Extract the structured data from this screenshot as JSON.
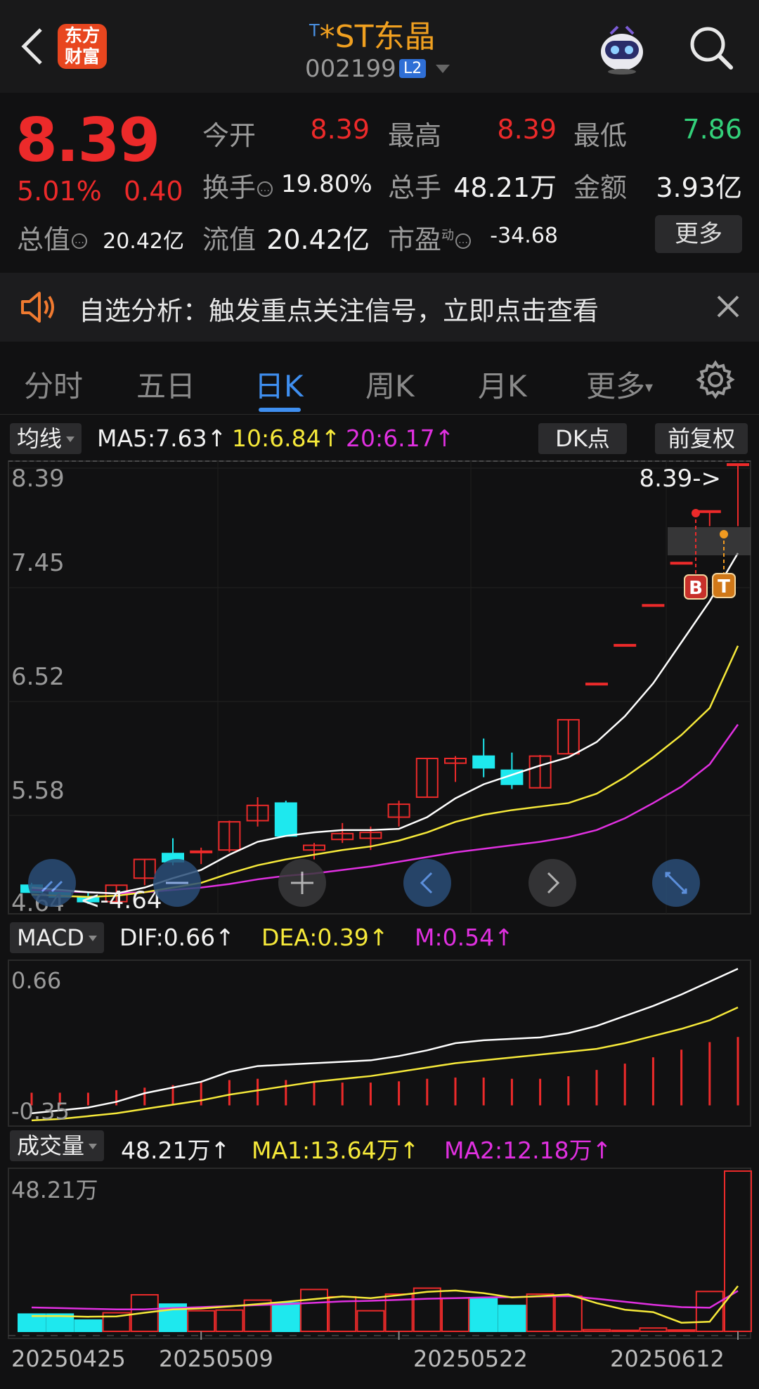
{
  "header": {
    "logo_line1": "东方",
    "logo_line2": "财富",
    "name_prefix": "T",
    "name": "*ST东晶",
    "code": "002199",
    "level_badge": "L2"
  },
  "quote": {
    "price": "8.39",
    "change_pct": "5.01%",
    "change": "0.40",
    "open_label": "今开",
    "open": "8.39",
    "high_label": "最高",
    "high": "8.39",
    "low_label": "最低",
    "low": "7.86",
    "turnover_label": "换手",
    "turnover": "19.80%",
    "volume_label": "总手",
    "volume": "48.21万",
    "amount_label": "金额",
    "amount": "3.93亿",
    "mktcap_label": "总值",
    "mktcap": "20.42亿",
    "float_label": "流值",
    "float_cap": "20.42亿",
    "pe_label": "市盈",
    "pe_sup": "动",
    "pe": "-34.68",
    "more_label": "更多"
  },
  "notice": {
    "text": "自选分析：触发重点关注信号，立即点击查看"
  },
  "tabs": [
    "分时",
    "五日",
    "日K",
    "周K",
    "月K",
    "更多"
  ],
  "active_tab": 2,
  "ma_bar": {
    "selector": "均线",
    "ma5": "MA5:7.63",
    "ma10": "10:6.84",
    "ma20": "20:6.17",
    "dk_label": "DK点",
    "adjust_label": "前复权"
  },
  "kline": {
    "axis_labels": [
      "8.39",
      "7.45",
      "6.52",
      "5.58",
      "4.64"
    ],
    "max_label": "8.39->",
    "min_label": "<-4.64",
    "buy_marker": "B",
    "t_marker": "T"
  },
  "macd_bar": {
    "selector": "MACD",
    "dif": "DIF:0.66",
    "dea": "DEA:0.39",
    "m": "M:0.54",
    "axis_top": "0.66",
    "axis_bottom": "-0.35"
  },
  "vol_bar": {
    "selector": "成交量",
    "vol": "48.21万",
    "ma1": "MA1:13.64万",
    "ma2": "MA2:12.18万",
    "axis_top": "48.21万"
  },
  "x_dates": [
    "20250425",
    "20250509",
    "20250522",
    "20250612"
  ],
  "colors": {
    "up": "#ec2a2a",
    "down": "#1ee8ee",
    "ma5": "#ffffff",
    "ma10": "#f6e93a",
    "ma20": "#e030e0",
    "accent": "#3f8ff0",
    "brand": "#e8461f",
    "name": "#f0a020"
  },
  "chart_data": {
    "type": "candlestick",
    "title": "*ST东晶",
    "candles": [
      {
        "o": 4.8,
        "h": 4.82,
        "l": 4.74,
        "c": 4.74
      },
      {
        "o": 4.74,
        "h": 4.75,
        "l": 4.64,
        "c": 4.7
      },
      {
        "o": 4.7,
        "h": 4.74,
        "l": 4.64,
        "c": 4.66
      },
      {
        "o": 4.66,
        "h": 4.8,
        "l": 4.64,
        "c": 4.8
      },
      {
        "o": 4.86,
        "h": 5.02,
        "l": 4.8,
        "c": 5.02
      },
      {
        "o": 5.07,
        "h": 5.2,
        "l": 4.97,
        "c": 5.0
      },
      {
        "o": 5.08,
        "h": 5.12,
        "l": 4.98,
        "c": 5.09
      },
      {
        "o": 5.1,
        "h": 5.35,
        "l": 5.08,
        "c": 5.34
      },
      {
        "o": 5.35,
        "h": 5.55,
        "l": 5.3,
        "c": 5.48
      },
      {
        "o": 5.5,
        "h": 5.52,
        "l": 5.22,
        "c": 5.22
      },
      {
        "o": 5.1,
        "h": 5.16,
        "l": 5.02,
        "c": 5.14
      },
      {
        "o": 5.19,
        "h": 5.33,
        "l": 5.16,
        "c": 5.24
      },
      {
        "o": 5.2,
        "h": 5.3,
        "l": 5.1,
        "c": 5.25
      },
      {
        "o": 5.38,
        "h": 5.52,
        "l": 5.3,
        "c": 5.49
      },
      {
        "o": 5.55,
        "h": 5.88,
        "l": 5.55,
        "c": 5.88
      },
      {
        "o": 5.84,
        "h": 5.9,
        "l": 5.68,
        "c": 5.88
      },
      {
        "o": 5.9,
        "h": 6.05,
        "l": 5.72,
        "c": 5.8
      },
      {
        "o": 5.78,
        "h": 5.93,
        "l": 5.62,
        "c": 5.66
      },
      {
        "o": 5.63,
        "h": 5.91,
        "l": 5.63,
        "c": 5.9
      },
      {
        "o": 5.92,
        "h": 6.21,
        "l": 5.92,
        "c": 6.21
      },
      {
        "o": 6.52,
        "h": 6.52,
        "l": 6.52,
        "c": 6.52
      },
      {
        "o": 6.85,
        "h": 6.85,
        "l": 6.85,
        "c": 6.85
      },
      {
        "o": 7.19,
        "h": 7.19,
        "l": 7.19,
        "c": 7.19
      },
      {
        "o": 7.55,
        "h": 7.55,
        "l": 7.55,
        "c": 7.55
      },
      {
        "o": 7.99,
        "h": 7.99,
        "l": 7.86,
        "c": 7.99
      },
      {
        "o": 8.39,
        "h": 8.39,
        "l": 7.86,
        "c": 8.39
      }
    ],
    "ma5": [
      4.78,
      4.76,
      4.74,
      4.73,
      4.78,
      4.86,
      4.93,
      5.06,
      5.17,
      5.22,
      5.25,
      5.27,
      5.27,
      5.28,
      5.38,
      5.54,
      5.66,
      5.74,
      5.82,
      5.89,
      6.02,
      6.24,
      6.52,
      6.87,
      7.22,
      7.63
    ],
    "ma10": [
      4.72,
      4.71,
      4.7,
      4.71,
      4.74,
      4.78,
      4.82,
      4.9,
      4.97,
      5.02,
      5.06,
      5.1,
      5.13,
      5.18,
      5.25,
      5.34,
      5.4,
      5.44,
      5.47,
      5.5,
      5.58,
      5.72,
      5.89,
      6.08,
      6.31,
      6.84
    ],
    "ma20": [
      4.76,
      4.75,
      4.74,
      4.73,
      4.74,
      4.76,
      4.78,
      4.81,
      4.85,
      4.88,
      4.9,
      4.93,
      4.96,
      5.0,
      5.04,
      5.08,
      5.11,
      5.14,
      5.17,
      5.21,
      5.27,
      5.37,
      5.5,
      5.64,
      5.83,
      6.17
    ],
    "y_range": [
      4.64,
      8.39
    ],
    "macd_hist": [
      0.1,
      0.1,
      0.1,
      0.12,
      0.14,
      0.16,
      0.18,
      0.2,
      0.21,
      0.2,
      0.19,
      0.18,
      0.18,
      0.19,
      0.21,
      0.22,
      0.22,
      0.21,
      0.21,
      0.23,
      0.28,
      0.33,
      0.38,
      0.44,
      0.5,
      0.54
    ],
    "dif": [
      -0.35,
      -0.33,
      -0.31,
      -0.27,
      -0.21,
      -0.17,
      -0.13,
      -0.06,
      -0.02,
      -0.01,
      0.0,
      0.01,
      0.02,
      0.05,
      0.09,
      0.14,
      0.16,
      0.17,
      0.18,
      0.21,
      0.26,
      0.33,
      0.4,
      0.48,
      0.57,
      0.66
    ],
    "dea": [
      -0.4,
      -0.39,
      -0.37,
      -0.35,
      -0.32,
      -0.29,
      -0.26,
      -0.22,
      -0.19,
      -0.16,
      -0.13,
      -0.11,
      -0.09,
      -0.06,
      -0.03,
      0.0,
      0.02,
      0.04,
      0.06,
      0.08,
      0.1,
      0.14,
      0.19,
      0.24,
      0.3,
      0.39
    ],
    "volume": [
      5.2,
      5.2,
      3.4,
      5.6,
      11.0,
      8.2,
      6.2,
      6.4,
      9.4,
      8.6,
      12.6,
      10.4,
      6.2,
      11.2,
      13.0,
      10.0,
      9.8,
      7.8,
      11.2,
      10.6,
      0.5,
      0.3,
      1.0,
      0.4,
      12.0,
      48.21
    ],
    "vol_ma1": [
      4.6,
      4.6,
      4.4,
      4.5,
      5.6,
      6.6,
      6.9,
      7.5,
      8.2,
      8.9,
      9.7,
      10.5,
      10.0,
      10.9,
      11.9,
      12.3,
      11.5,
      10.2,
      10.6,
      11.1,
      8.5,
      6.5,
      5.8,
      2.6,
      2.9,
      13.64
    ],
    "vol_ma2": [
      7.2,
      7.0,
      6.8,
      6.6,
      6.6,
      7.0,
      7.3,
      7.6,
      7.9,
      8.2,
      8.6,
      9.0,
      9.2,
      9.5,
      9.8,
      10.0,
      10.2,
      10.3,
      10.5,
      10.6,
      9.8,
      8.9,
      8.0,
      7.3,
      7.1,
      12.18
    ]
  }
}
